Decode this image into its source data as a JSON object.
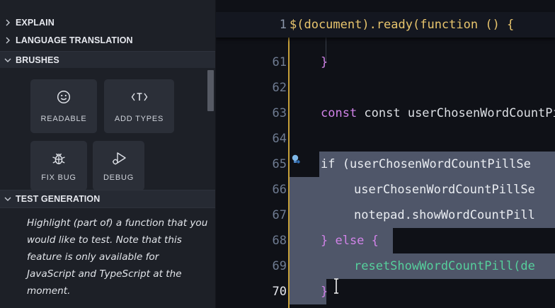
{
  "sidebar": {
    "sections": [
      {
        "label": "EXPLAIN",
        "state": "collapsed"
      },
      {
        "label": "LANGUAGE TRANSLATION",
        "state": "collapsed"
      },
      {
        "label": "BRUSHES",
        "state": "expanded"
      },
      {
        "label": "TEST GENERATION",
        "state": "expanded"
      }
    ],
    "brushes": [
      {
        "label": "READABLE",
        "icon": "smiley-icon"
      },
      {
        "label": "ADD TYPES",
        "icon": "type-tag-icon"
      },
      {
        "label": "FIX BUG",
        "icon": "bug-icon"
      },
      {
        "label": "DEBUG",
        "icon": "debug-play-icon"
      }
    ],
    "test_generation_help": "Highlight (part of) a function that you would like to test. Note that this feature is only available for JavaScript and TypeScript at the moment."
  },
  "editor": {
    "sticky_line": {
      "number": "1",
      "code": "$(document).ready(function () {"
    },
    "lines": [
      {
        "number": "61",
        "code": "}"
      },
      {
        "number": "62",
        "code": ""
      },
      {
        "number": "63",
        "code": "const userChosenWordCountPill"
      },
      {
        "number": "64",
        "code": ""
      },
      {
        "number": "65",
        "code": "if (userChosenWordCountPillSe"
      },
      {
        "number": "66",
        "code": "userChosenWordCountPillSe"
      },
      {
        "number": "67",
        "code": "notepad.showWordCountPill"
      },
      {
        "number": "68",
        "code": "} else {"
      },
      {
        "number": "69",
        "code": "resetShowWordCountPill(de"
      },
      {
        "number": "70",
        "code": "}"
      }
    ],
    "active_line": "70",
    "colors": {
      "selection": "#4f5669",
      "keyword": "#d183e8",
      "function": "#56cf9c",
      "gutter_rule": "#c59f3a"
    }
  }
}
